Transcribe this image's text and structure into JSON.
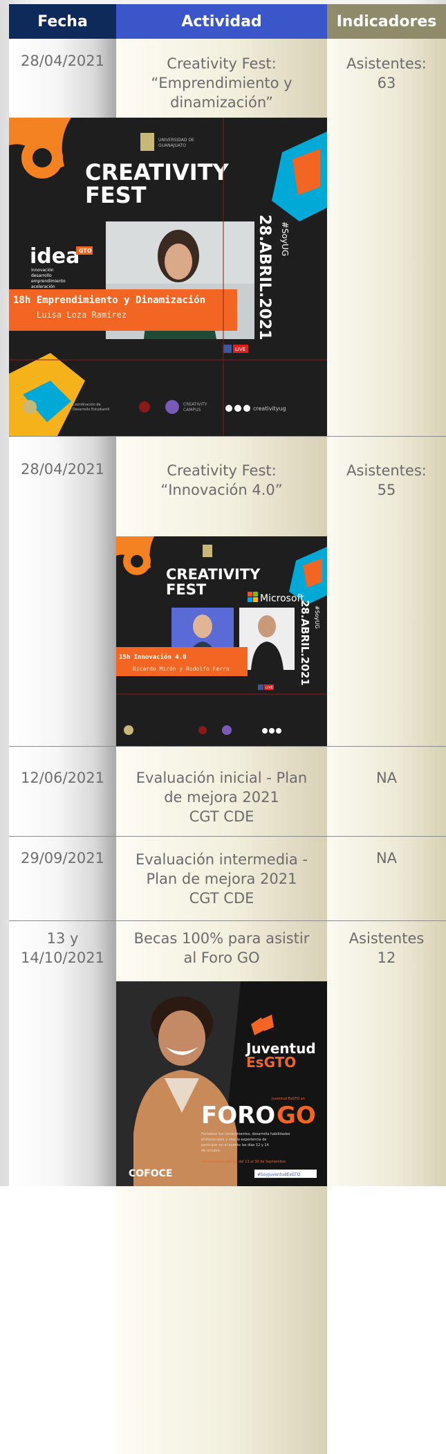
{
  "headers": {
    "fecha": "Fecha",
    "actividad": "Actividad",
    "indicadores": "Indicadores"
  },
  "rows": [
    {
      "fecha": "28/04/2021",
      "actividad_l1": "Creativity Fest:",
      "actividad_l2": "“Emprendimiento y",
      "actividad_l3": "dinamización”",
      "ind_l1": "Asistentes:",
      "ind_l2": "63"
    },
    {
      "fecha": "28/04/2021",
      "actividad_l1": "Creativity Fest:",
      "actividad_l2": "“Innovación 4.0”",
      "ind_l1": "Asistentes:",
      "ind_l2": "55"
    },
    {
      "fecha": "12/06/2021",
      "actividad_l1": "Evaluación inicial - Plan",
      "actividad_l2": "de mejora 2021",
      "actividad_l3": "CGT CDE",
      "ind_l1": "NA"
    },
    {
      "fecha": "29/09/2021",
      "actividad_l1": "Evaluación intermedia -",
      "actividad_l2": "Plan de mejora 2021",
      "actividad_l3": "CGT CDE",
      "ind_l1": "NA"
    },
    {
      "fecha_l1": "13 y",
      "fecha_l2": "14/10/2021",
      "actividad_l1": "Becas 100% para asistir",
      "actividad_l2": "al Foro GO",
      "ind_l1": "Asistentes",
      "ind_l2": "12"
    }
  ],
  "poster1": {
    "title1": "CREATIVITY",
    "title2": "FEST",
    "brand": "idea",
    "brand_badge": "GTO",
    "brand_sub": "innovación\ndesarrollo\nemprendimiento\naceleración",
    "date_v": "28.ABRIL.2021",
    "hashtag": "#SoyUG",
    "banner1": "18h Emprendimiento y Dinamización",
    "banner2": "Luisa Loza Ramírez",
    "live": "LIVE",
    "handle": "creativityug",
    "campus": "CREATIVITY CAMPUS"
  },
  "poster2": {
    "title1": "CREATIVITY",
    "title2": "FEST",
    "partner": "Microsoft",
    "date_v": "28.ABRIL.2021",
    "hashtag": "#SoyUG",
    "banner1": "15h Innovación 4.0",
    "banner2": "Ricardo Mirón y Rodolfo Ferro",
    "live": "LIVE"
  },
  "poster3": {
    "brand1": "Juventud",
    "brand2": "EsGTO",
    "foro": "FORO",
    "foro2": "GO",
    "tagline": "Fortalece tus conocimientos, desarrolla habilidades profesionales y vive la experiencia de participar en el evento los días 12 y 14 de octubre.",
    "convocatoria": "Convocatoria abierta del 13 al 30 de Septiembre",
    "hashtag": "#SoyJuventudEsGTO",
    "coface": "COFOCE",
    "small": "Juventud EsGTO en"
  },
  "colors": {
    "fecha_header": "#0e2a5a",
    "actividad_header": "#3a56c9",
    "indicadores_header": "#8f8a6a",
    "orange": "#f26522",
    "text": "#6b6b6b"
  }
}
